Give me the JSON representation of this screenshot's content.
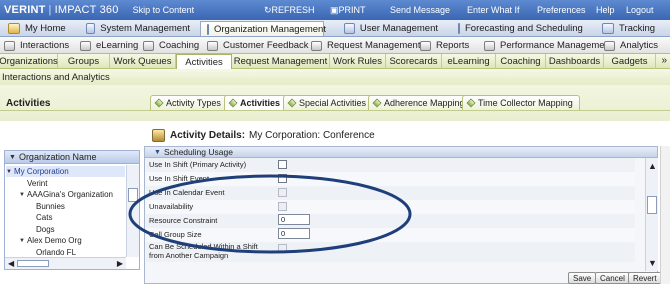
{
  "header": {
    "brand": "VERINT",
    "separator": "|",
    "product": "IMPACT 360",
    "skip_link": "Skip to Content",
    "links": [
      "REFRESH",
      "PRINT",
      "Send Message",
      "Enter What If",
      "Preferences",
      "Help",
      "Logout"
    ]
  },
  "modules": [
    {
      "label": "My Home",
      "icon": "home-icon",
      "active": false
    },
    {
      "label": "System Management",
      "icon": "system-icon",
      "active": false
    },
    {
      "label": "Organization Management",
      "icon": "organization-icon",
      "active": true
    },
    {
      "label": "User Management",
      "icon": "users-icon",
      "active": false
    },
    {
      "label": "Forecasting and Scheduling",
      "icon": "calendar-icon",
      "active": false
    },
    {
      "label": "Tracking",
      "icon": "tracking-icon",
      "active": false
    }
  ],
  "subnav": [
    {
      "label": "Interactions",
      "icon": "interactions-icon"
    },
    {
      "label": "eLearning",
      "icon": "elearning-icon"
    },
    {
      "label": "Coaching",
      "icon": "coaching-icon"
    },
    {
      "label": "Customer Feedback",
      "icon": "feedback-icon"
    },
    {
      "label": "Request Management",
      "icon": "request-icon"
    },
    {
      "label": "Reports",
      "icon": "reports-icon"
    },
    {
      "label": "Performance Management",
      "icon": "performance-icon"
    },
    {
      "label": "Analytics",
      "icon": "analytics-icon"
    }
  ],
  "tabs": [
    "Organizations",
    "Groups",
    "Work Queues",
    "Activities",
    "Request Management",
    "Work Rules",
    "Scorecards",
    "eLearning",
    "Coaching",
    "Dashboards",
    "Gadgets"
  ],
  "active_tab": "Activities",
  "tabs_row2": [
    "Interactions and Analytics"
  ],
  "section": {
    "title": "Activities",
    "subtabs": [
      "Activity Types",
      "Activities",
      "Special Activities",
      "Adherence Mapping",
      "Time Collector Mapping"
    ],
    "active_subtab": "Activities"
  },
  "details": {
    "label": "Activity Details:",
    "value": "My Corporation: Conference"
  },
  "org_panel": {
    "header": "Organization Name",
    "tree": [
      {
        "label": "My Corporation",
        "level": 0,
        "expanded": true,
        "selected": true
      },
      {
        "label": "Verint",
        "level": 1,
        "expanded": false
      },
      {
        "label": "AAAGina's Organization",
        "level": 1,
        "expanded": true
      },
      {
        "label": "Bunnies",
        "level": 2,
        "expanded": false
      },
      {
        "label": "Cats",
        "level": 2,
        "expanded": false
      },
      {
        "label": "Dogs",
        "level": 2,
        "expanded": false
      },
      {
        "label": "Alex Demo Org",
        "level": 1,
        "expanded": true
      },
      {
        "label": "Orlando FL",
        "level": 2,
        "expanded": false
      }
    ]
  },
  "scheduling": {
    "header": "Scheduling Usage",
    "fields": [
      {
        "label": "Use In Shift (Primary Activity)",
        "type": "checkbox",
        "checked": false,
        "disabled": false
      },
      {
        "label": "Use In Shift Event",
        "type": "checkbox",
        "checked": false,
        "disabled": false
      },
      {
        "label": "Use In Calendar Event",
        "type": "checkbox",
        "checked": false,
        "disabled": true
      },
      {
        "label": "Unavailability",
        "type": "checkbox",
        "checked": false,
        "disabled": true
      },
      {
        "label": "Resource Constraint",
        "type": "number",
        "value": "0"
      },
      {
        "label": "Cell Group Size",
        "type": "number",
        "value": "0"
      },
      {
        "label": "Can Be Scheduled Within a Shift from Another Campaign",
        "type": "checkbox",
        "checked": false,
        "disabled": true
      }
    ]
  },
  "buttons": [
    "Save",
    "Cancel",
    "Revert"
  ],
  "colors": {
    "header_blue": "#3a66b3",
    "tab_green": "#dfe6b8",
    "annotation_ellipse": "#1f3f7a"
  }
}
